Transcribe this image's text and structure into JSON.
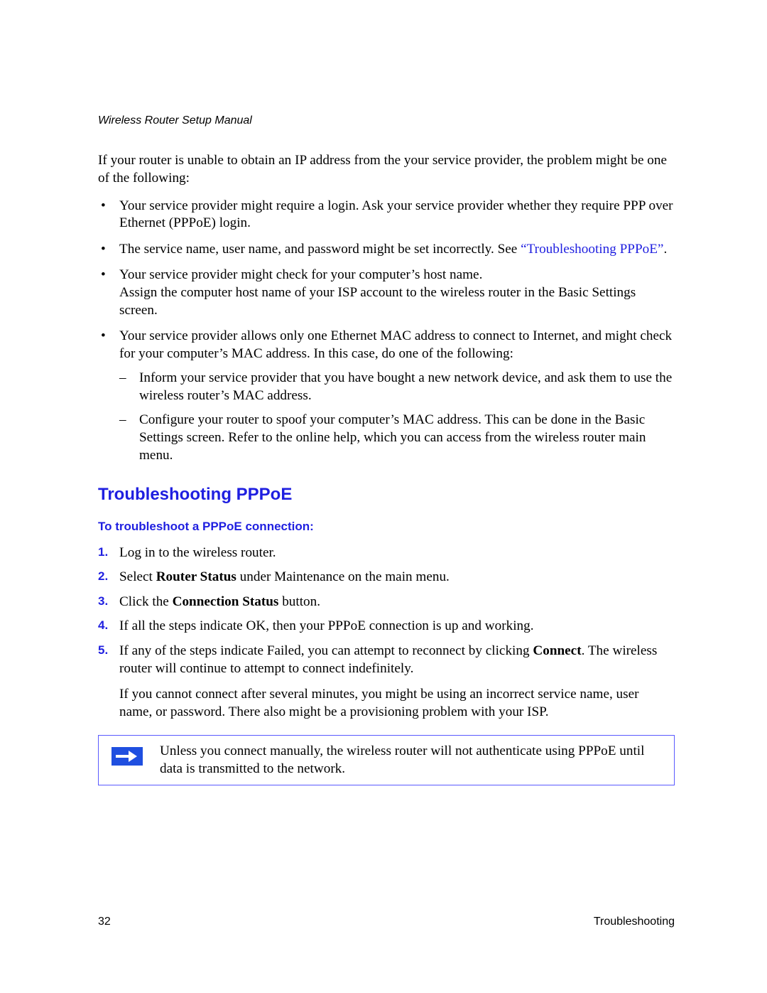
{
  "header": {
    "running_title": "Wireless Router Setup Manual"
  },
  "intro": "If your router is unable to obtain an IP address from the your service provider, the problem might be one of the following:",
  "bullets": {
    "b1": "Your service provider might require a login. Ask your service provider whether they require PPP over Ethernet (PPPoE) login.",
    "b2_pre": "The service name, user name, and password might be set incorrectly. See ",
    "b2_link": "“Troubleshooting PPPoE”",
    "b2_post": ".",
    "b3_line1": "Your service provider might check for your computer’s host name.",
    "b3_line2": "Assign the computer host name of your ISP account to the wireless router in the Basic Settings screen.",
    "b4": "Your service provider allows only one Ethernet MAC address to connect to Internet, and might check for your computer’s MAC address. In this case, do one of the following:",
    "b4_d1": "Inform your service provider that you have bought a new network device, and ask them to use the wireless router’s MAC address.",
    "b4_d2": "Configure your router to spoof your computer’s MAC address. This can be done in the Basic Settings screen. Refer to the online help, which you can access from the wireless router main menu."
  },
  "section": {
    "title": "Troubleshooting PPPoE",
    "subtitle": "To troubleshoot a PPPoE connection:"
  },
  "steps": {
    "s1": "Log in to the wireless router.",
    "s2_pre": "Select ",
    "s2_bold": "Router Status",
    "s2_post": " under Maintenance on the main menu.",
    "s3_pre": "Click the ",
    "s3_bold": "Connection Status",
    "s3_post": " button.",
    "s4": "If all the steps indicate OK, then your PPPoE connection is up and working.",
    "s5_pre": "If any of the steps indicate Failed, you can attempt to reconnect by clicking ",
    "s5_bold": "Connect",
    "s5_post": ". The wireless router will continue to attempt to connect indefinitely."
  },
  "after_steps": "If you cannot connect after several minutes, you might be using an incorrect service name, user name, or password. There also might be a provisioning problem with your ISP.",
  "note": "Unless you connect manually, the wireless router will not authenticate using PPPoE until data is transmitted to the network.",
  "footer": {
    "page_number": "32",
    "section_name": "Troubleshooting"
  }
}
